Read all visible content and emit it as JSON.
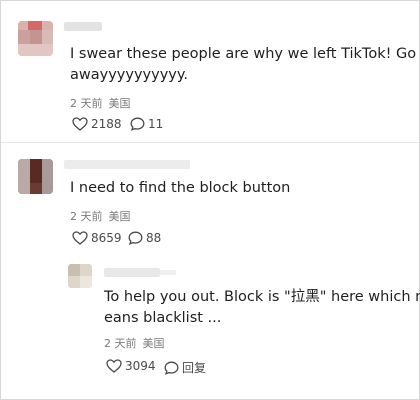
{
  "comments": [
    {
      "text_lines": [
        "I swear these people are why we left TikTok! Go",
        "awayyyyyyyyyy."
      ],
      "time": "2 天前",
      "location": "美国",
      "likes": "2188",
      "replies": "11"
    },
    {
      "text_lines": [
        "I need to find the block button"
      ],
      "time": "2 天前",
      "location": "美国",
      "likes": "8659",
      "replies": "88"
    },
    {
      "text_lines": [
        "To help you out. Block is \"拉黑\" here which m",
        "eans blacklist ..."
      ],
      "time": "2 天前",
      "location": "美国",
      "likes": "3094",
      "reply_label": "回复"
    }
  ],
  "colors": {
    "text": "#1f1f1f",
    "meta": "#7a7a7a",
    "icon": "#4a4a4a"
  },
  "icons": {
    "like": "heart-outline",
    "reply": "speech-bubble-outline"
  }
}
